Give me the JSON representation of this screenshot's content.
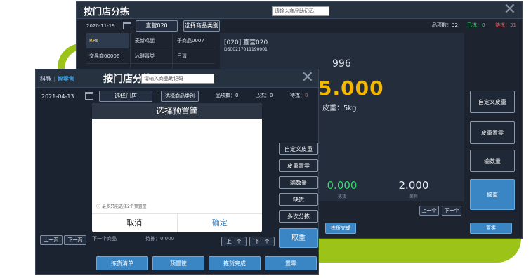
{
  "colors": {
    "accent_green": "#9cc418",
    "brand_blue": "#3a86c5",
    "highlight_yellow": "#f5b800",
    "ok_green": "#35d86d",
    "alert_red": "#f25555"
  },
  "back": {
    "title": "按门店分拣",
    "search_placeholder": "请输入商品助记码",
    "date": "2020-11-19",
    "store_button": "直营020",
    "category_button": "选择商品类别",
    "count_label": "品项数：32",
    "done_label": "已拣：0",
    "pending_label": "待拣：31",
    "sidebar": [
      "RRs",
      "交易商00006",
      "..."
    ],
    "goods": [
      [
        "麦新鸡腿",
        "子商品0007"
      ],
      [
        "冰鲜毒类",
        "日清"
      ],
      [
        "",
        ""
      ]
    ],
    "customer_title": "[020] 直营020",
    "order_no": "DS00217011190001",
    "product_code": "996",
    "weight_value": "5.000",
    "tare_label": "皮重：5kg",
    "picked_value": "0.000",
    "picked_label": "拣货",
    "diff_value": "2.000",
    "diff_label": "差异",
    "right_buttons": [
      "自定义皮重",
      "皮重置零",
      "输数量",
      "取重"
    ],
    "prev_button": "上一个",
    "next_button": "下一个",
    "bottom_left_button": "拣货完成",
    "bottom_right_button": "置零"
  },
  "front": {
    "brand_name": "科脉",
    "brand_name2": "智零售",
    "title": "按门店分拣",
    "search_placeholder": "请输入商品助记码",
    "date": "2021-04-13",
    "store_button": "选择门店",
    "category_button": "选择商品类别",
    "count_label": "品项数：0",
    "done_label": "已拣：0",
    "pending_label": "待拣：",
    "pending_value": "0",
    "right_buttons": [
      "自定义皮重",
      "皮重置零",
      "输数量",
      "缺货",
      "多次分拣"
    ],
    "take_weight_button": "取重",
    "prev_page": "上一页",
    "next_page": "下一页",
    "next_goods_label": "下一个商品",
    "to_pick_label": "待拣：0.000",
    "prev_button": "上一个",
    "next_button": "下一个",
    "bottom_buttons": [
      "拣货清单",
      "预置筐",
      "拣货完成",
      "置零"
    ]
  },
  "dialog": {
    "title": "选择预置筐",
    "hint": "最多只能选择2个预置筐",
    "cancel": "取消",
    "confirm": "确定"
  }
}
